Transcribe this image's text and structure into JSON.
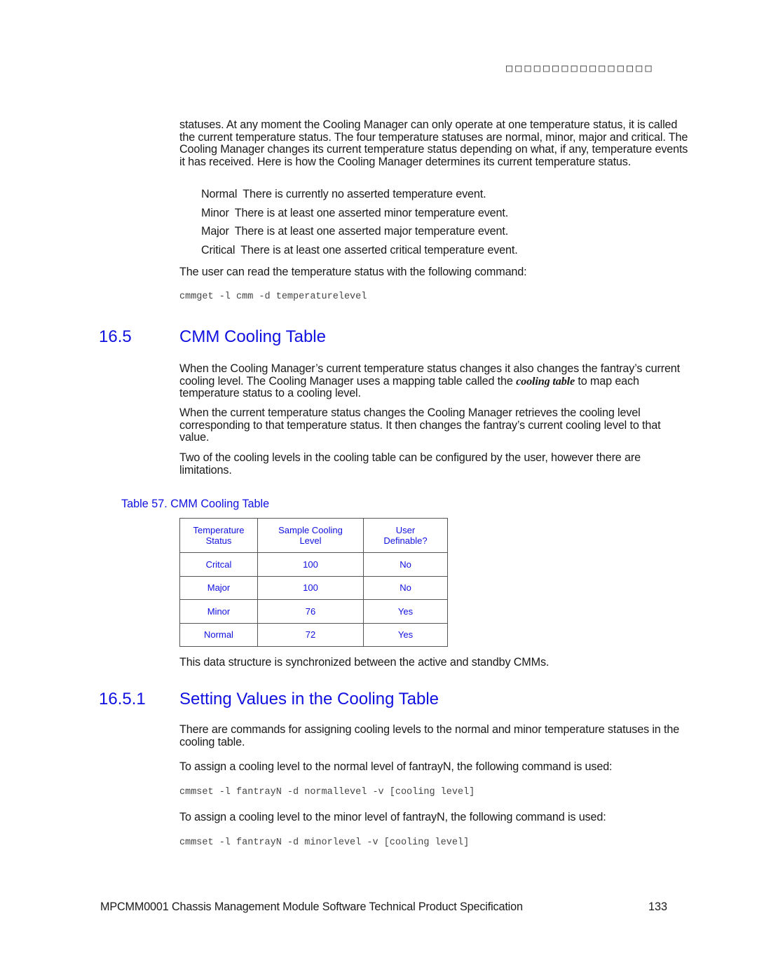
{
  "header": {
    "running_header": "□□□□□□□□□□□□□□□□"
  },
  "intro": {
    "paragraph": "statuses. At any moment the Cooling Manager can only operate at one temperature status, it is called the current temperature status. The four temperature statuses are normal, minor, major and critical. The Cooling Manager changes its current temperature status depending on what, if any, temperature events it has received. Here is how the Cooling Manager determines its current temperature status.",
    "definitions": [
      {
        "term": "Normal",
        "description": "There is currently no asserted temperature event."
      },
      {
        "term": "Minor",
        "description": "There is at least one asserted minor temperature event."
      },
      {
        "term": "Major",
        "description": "There is at least one asserted major temperature event."
      },
      {
        "term": "Critical",
        "description": "There is at least one asserted critical temperature event."
      }
    ],
    "read_command_text": "The user can read the temperature status with the following command:",
    "read_command": "cmmget -l cmm -d temperaturelevel"
  },
  "section_16_5": {
    "number": "16.5",
    "title": "CMM Cooling Table",
    "para1_before": "When the Cooling Manager’s current temperature status changes it also changes the fantray’s current cooling level. The Cooling Manager uses a mapping table called the ",
    "para1_term": "cooling table",
    "para1_after": " to map each temperature status to a cooling level.",
    "para2": "When the current temperature status changes the Cooling Manager retrieves the cooling level corresponding to that temperature status. It then changes the fantray’s current cooling level to that value.",
    "para3": "Two of the cooling levels in the cooling table can be configured by the user, however there are limitations.",
    "table_caption": "Table 57.  CMM Cooling Table",
    "table": {
      "headers": [
        [
          "Temperature",
          "Status"
        ],
        [
          "Sample Cooling",
          "Level"
        ],
        [
          "User",
          "Definable?"
        ]
      ],
      "rows": [
        [
          "Critcal",
          "100",
          "No"
        ],
        [
          "Major",
          "100",
          "No"
        ],
        [
          "Minor",
          "76",
          "Yes"
        ],
        [
          "Normal",
          "72",
          "Yes"
        ]
      ]
    },
    "after_table": "This data structure is synchronized between the active and standby CMMs."
  },
  "section_16_5_1": {
    "number": "16.5.1",
    "title": "Setting Values in the Cooling Table",
    "para1": "There are commands for assigning cooling levels to the normal and minor temperature statuses in the cooling table.",
    "para2": "To assign a cooling level to the normal level of fantrayN, the following command is used:",
    "command_normal": "cmmset -l fantrayN -d normallevel -v [cooling level]",
    "para3": "To assign a cooling level to the minor level of fantrayN, the following command is used:",
    "command_minor": "cmmset -l fantrayN -d minorlevel -v [cooling level]"
  },
  "footer": {
    "document_title": "MPCMM0001 Chassis Management Module Software Technical Product Specification",
    "page_number": "133"
  }
}
